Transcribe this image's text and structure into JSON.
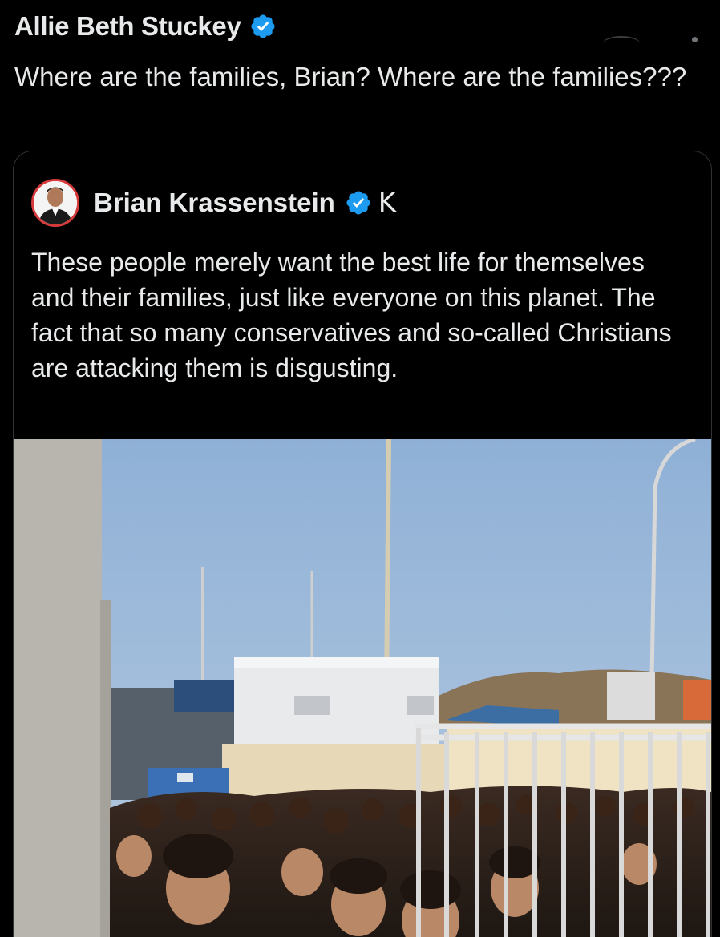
{
  "post": {
    "author_name": "Allie Beth Stuckey",
    "text": "Where are the families, Brian? Where are the families???"
  },
  "quoted_post": {
    "author_name": "Brian Krassenstein",
    "affiliate_badge": "K",
    "text": "These people merely want the best life for themselves and their families, just like everyone on this planet. The fact that so many conservatives and so-called Christians are attacking them is disgusting."
  },
  "icons": {
    "verified": "verified-badge-icon",
    "menu": "more-options-icon"
  },
  "colors": {
    "background": "#000000",
    "text": "#e7e9ea",
    "verified_blue": "#1d9bf0",
    "card_border": "#2f3336"
  }
}
